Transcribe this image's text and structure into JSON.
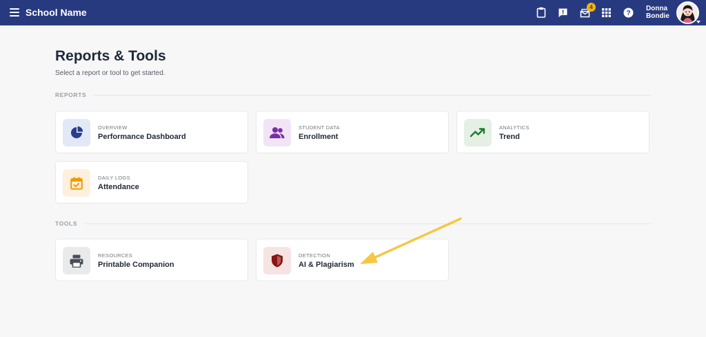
{
  "header": {
    "school_name": "School Name",
    "notification_count": "4",
    "user_first": "Donna",
    "user_last": "Bondie",
    "icons": [
      "clipboard-icon",
      "alert-message-icon",
      "inbox-icon",
      "apps-grid-icon",
      "help-icon"
    ]
  },
  "page": {
    "title": "Reports & Tools",
    "subtitle": "Select a report or tool to get started."
  },
  "sections": {
    "reports_label": "REPORTS",
    "tools_label": "TOOLS"
  },
  "reports": [
    {
      "kicker": "OVERVIEW",
      "title": "Performance Dashboard",
      "icon": "pie-chart-icon",
      "icon_bg": "#e3e8f6",
      "icon_color": "#2a3d8f"
    },
    {
      "kicker": "STUDENT DATA",
      "title": "Enrollment",
      "icon": "users-icon",
      "icon_bg": "#f1e4f6",
      "icon_color": "#7b2fa6"
    },
    {
      "kicker": "ANALYTICS",
      "title": "Trend",
      "icon": "trending-up-icon",
      "icon_bg": "#e3f0e3",
      "icon_color": "#1f7a2a"
    },
    {
      "kicker": "DAILY LOGS",
      "title": "Attendance",
      "icon": "calendar-check-icon",
      "icon_bg": "#fdf0dd",
      "icon_color": "#f29900"
    }
  ],
  "tools": [
    {
      "kicker": "RESOURCES",
      "title": "Printable Companion",
      "icon": "printer-icon",
      "icon_bg": "#e9eaec",
      "icon_color": "#4a4f57"
    },
    {
      "kicker": "DETECTION",
      "title": "AI & Plagiarism",
      "icon": "shield-icon",
      "icon_bg": "#f6e3e3",
      "icon_color": "#8a1414"
    }
  ],
  "colors": {
    "header_bg": "#283a7f",
    "badge_bg": "#f5b400",
    "arrow": "#f6c744"
  }
}
